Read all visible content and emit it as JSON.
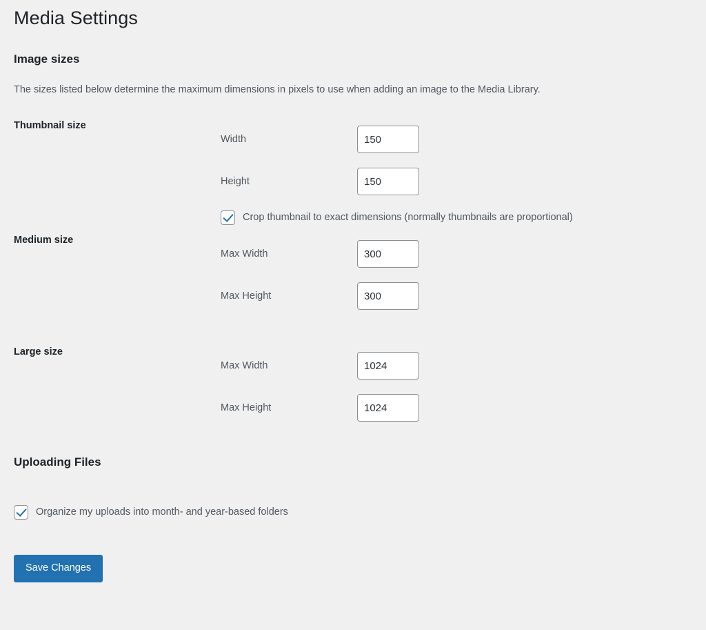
{
  "page": {
    "title": "Media Settings"
  },
  "image_sizes": {
    "heading": "Image sizes",
    "description": "The sizes listed below determine the maximum dimensions in pixels to use when adding an image to the Media Library.",
    "rows": [
      {
        "label": "Thumbnail size",
        "fields": [
          {
            "label": "Width",
            "value": "150"
          },
          {
            "label": "Height",
            "value": "150"
          }
        ],
        "checkbox": {
          "label": "Crop thumbnail to exact dimensions (normally thumbnails are proportional)",
          "checked": true
        }
      },
      {
        "label": "Medium size",
        "fields": [
          {
            "label": "Max Width",
            "value": "300"
          },
          {
            "label": "Max Height",
            "value": "300"
          }
        ]
      },
      {
        "label": "Large size",
        "fields": [
          {
            "label": "Max Width",
            "value": "1024"
          },
          {
            "label": "Max Height",
            "value": "1024"
          }
        ]
      }
    ]
  },
  "uploading_files": {
    "heading": "Uploading Files",
    "checkbox": {
      "label": "Organize my uploads into month- and year-based folders",
      "checked": true
    }
  },
  "submit": {
    "save_label": "Save Changes"
  },
  "colors": {
    "background": "#f0f0f1",
    "primary": "#2271b1",
    "heading_text": "#1d2327",
    "body_text": "#50575e",
    "input_border": "#8c8f94"
  }
}
